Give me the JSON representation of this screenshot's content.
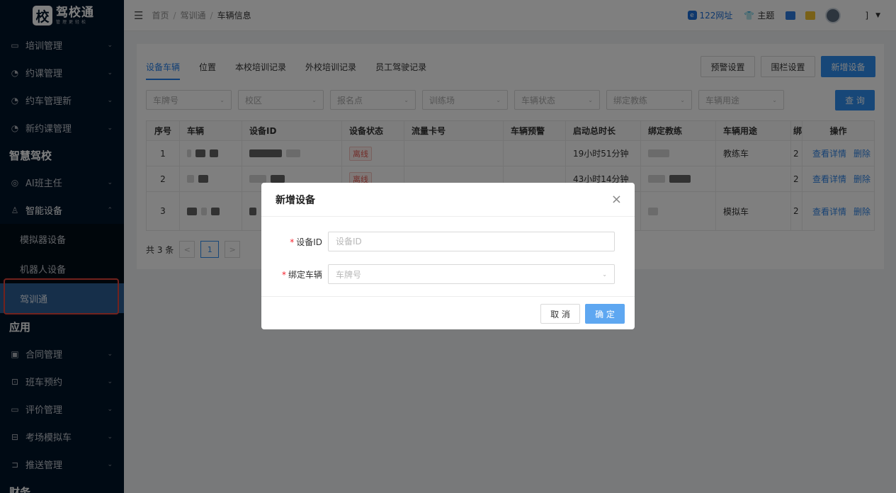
{
  "brand": {
    "mark": "校",
    "name": "驾校通",
    "slogan": "管理更轻松"
  },
  "sidebar": {
    "items_top": [
      {
        "label": "培训管理",
        "icon": "chat-icon"
      },
      {
        "label": "约课管理",
        "icon": "gauge-icon"
      },
      {
        "label": "约车管理新",
        "icon": "gauge-icon"
      },
      {
        "label": "新约课管理",
        "icon": "gauge-icon"
      }
    ],
    "section_smart": "智慧驾校",
    "ai_teacher": "AI班主任",
    "smart_device": "智能设备",
    "smart_device_children": [
      "模拟器设备",
      "机器人设备",
      "驾训通"
    ],
    "section_apps": "应用",
    "items_apps": [
      {
        "label": "合同管理",
        "icon": "contract-icon"
      },
      {
        "label": "班车预约",
        "icon": "bus-icon"
      },
      {
        "label": "评价管理",
        "icon": "chat-icon"
      },
      {
        "label": "考场模拟车",
        "icon": "car-icon"
      },
      {
        "label": "推送管理",
        "icon": "push-icon"
      }
    ],
    "section_finance": "财务"
  },
  "header": {
    "breadcrumb": [
      "首页",
      "驾训通",
      "车辆信息"
    ],
    "link_122": "122网址",
    "theme": "主题",
    "user_tail": "]",
    "theme_colors": {
      "blue": "#2f7de0",
      "yellow": "#f2c230"
    }
  },
  "tabs": [
    "设备车辆",
    "位置",
    "本校培训记录",
    "外校培训记录",
    "员工驾驶记录"
  ],
  "actions": {
    "warning_settings": "预警设置",
    "fence_settings": "围栏设置",
    "add_device": "新增设备",
    "query": "查 询"
  },
  "filters": [
    "车牌号",
    "校区",
    "报名点",
    "训练场",
    "车辆状态",
    "绑定教练",
    "车辆用途"
  ],
  "table": {
    "columns": [
      "序号",
      "车辆",
      "设备ID",
      "设备状态",
      "流量卡号",
      "车辆预警",
      "启动总时长",
      "绑定教练",
      "车辆用途",
      "绑",
      "操作"
    ],
    "rows": [
      {
        "index": "1",
        "status": "离线",
        "duration": "19小时51分钟",
        "usage": "教练车",
        "extra": "2",
        "view": "查看详情",
        "delete": "删除"
      },
      {
        "index": "2",
        "status": "离线",
        "duration": "43小时14分钟",
        "usage": "",
        "extra": "2",
        "view": "查看详情",
        "delete": "删除"
      },
      {
        "index": "3",
        "status": "",
        "duration": "",
        "usage": "模拟车",
        "extra": "2",
        "view": "查看详情",
        "delete": "删除"
      }
    ]
  },
  "pagination": {
    "total": "共 3 条",
    "current": "1",
    "prev": "<",
    "next": ">"
  },
  "modal": {
    "title": "新增设备",
    "close": "×",
    "device_id_label": "设备ID",
    "device_id_placeholder": "设备ID",
    "device_id_value": "",
    "bind_vehicle_label": "绑定车辆",
    "bind_vehicle_placeholder": "车牌号",
    "required_mark": "*",
    "cancel": "取 消",
    "ok": "确 定"
  }
}
